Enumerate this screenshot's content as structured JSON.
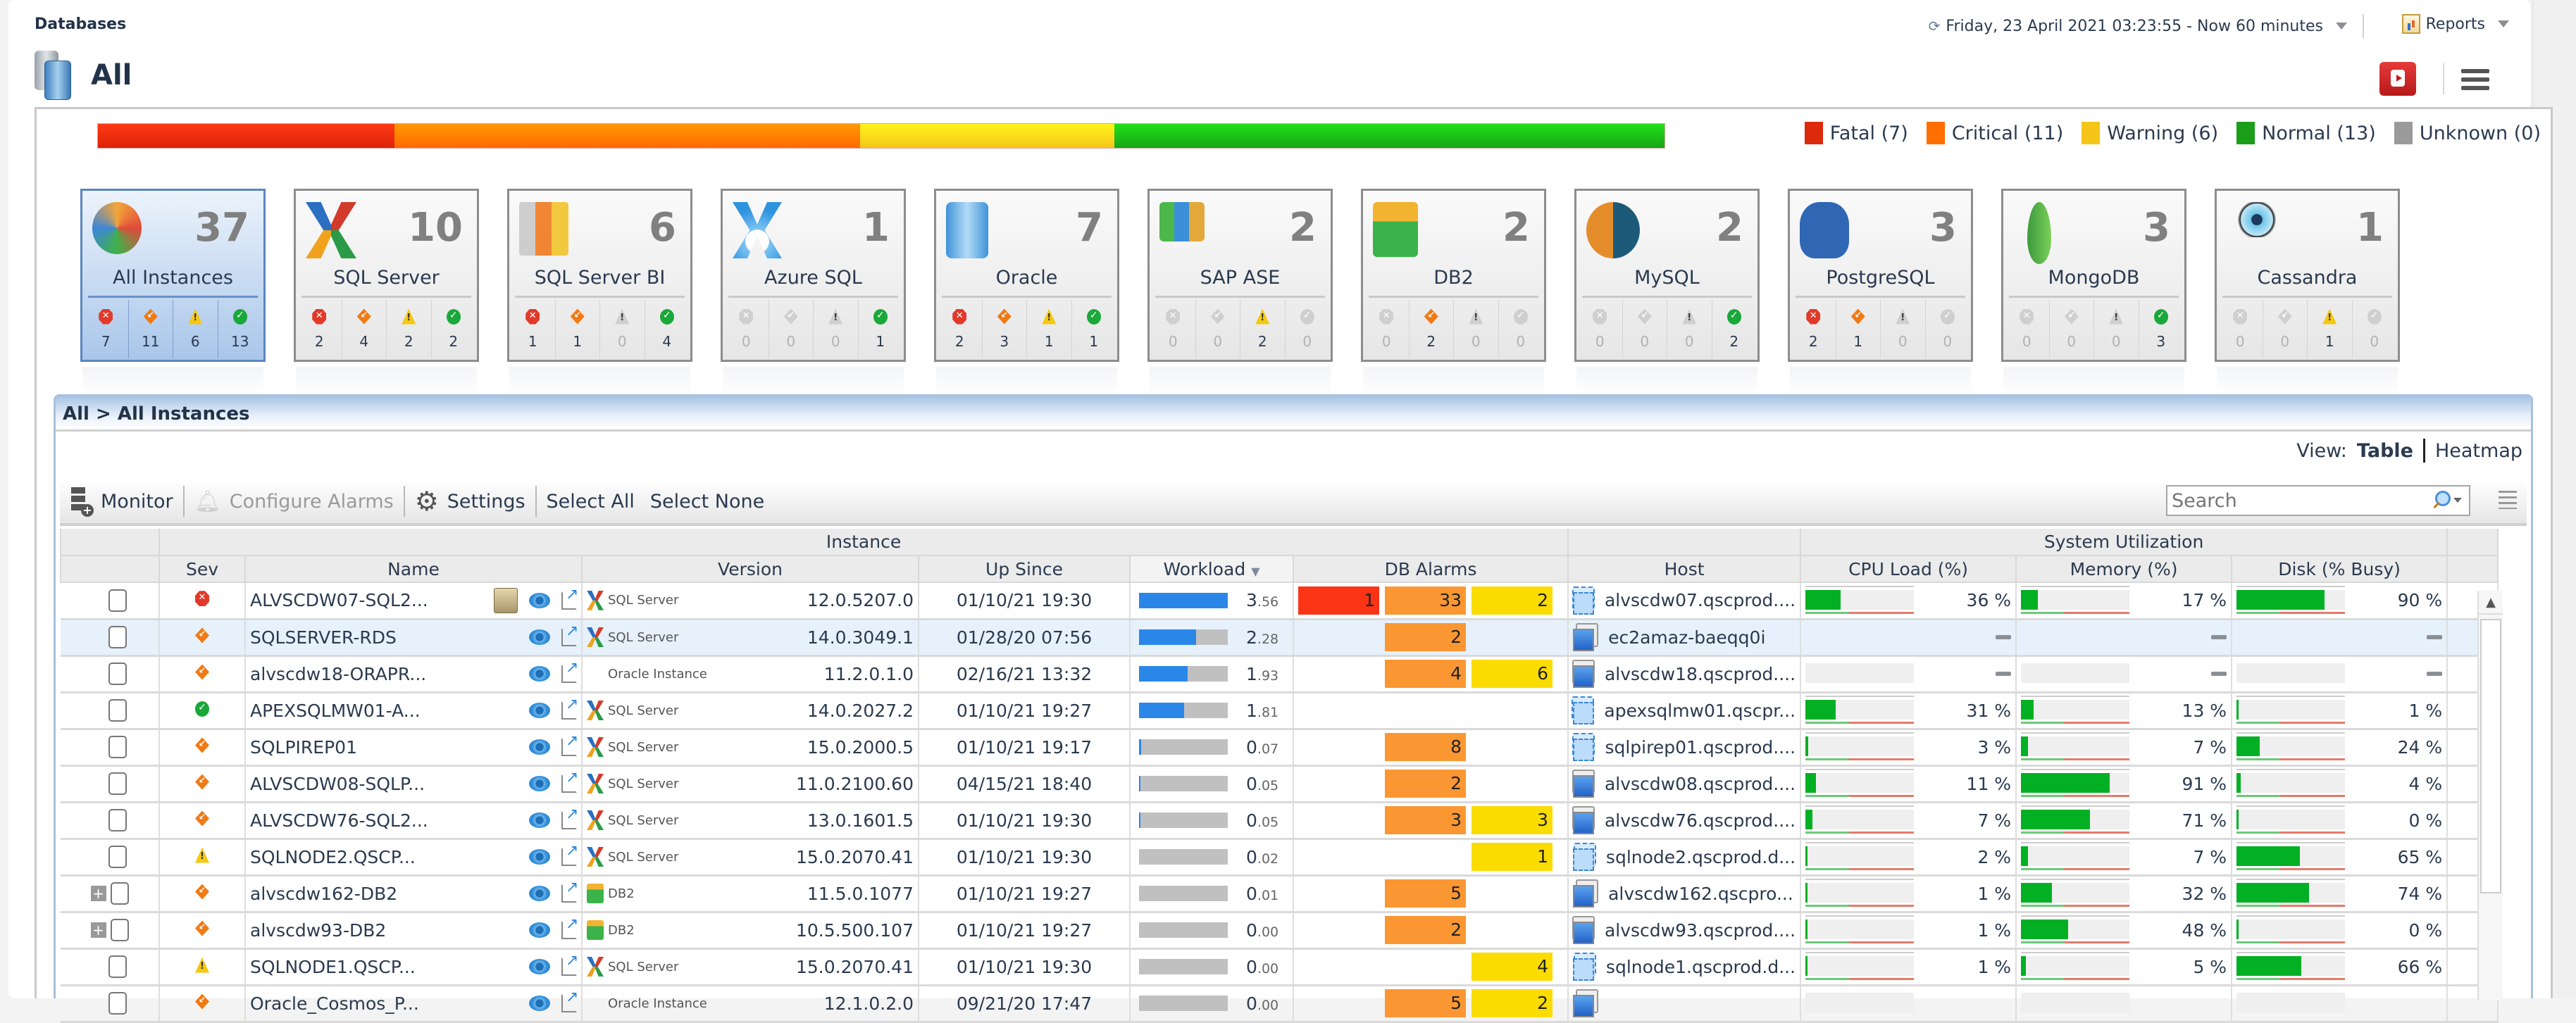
{
  "header": {
    "breadcrumb": "Databases",
    "time_range": "Friday, 23 April 2021 03:23:55 - Now 60 minutes",
    "reports_label": "Reports",
    "page_title": "All"
  },
  "health": {
    "legend": [
      {
        "key": "fatal",
        "label": "Fatal (7)",
        "count": 7,
        "color": "#dd2a0c"
      },
      {
        "key": "critical",
        "label": "Critical (11)",
        "count": 11,
        "color": "#ff6e00"
      },
      {
        "key": "warning",
        "label": "Warning (6)",
        "count": 6,
        "color": "#f5c518"
      },
      {
        "key": "normal",
        "label": "Normal (13)",
        "count": 13,
        "color": "#1a9e1a"
      },
      {
        "key": "unknown",
        "label": "Unknown (0)",
        "count": 0,
        "color": "#9a9a9a"
      }
    ],
    "total": 37
  },
  "cards": [
    {
      "name": "All Instances",
      "count": "37",
      "icon": "all-instances-icon",
      "selected": true,
      "stats": [
        "7",
        "11",
        "6",
        "13"
      ]
    },
    {
      "name": "SQL Server",
      "count": "10",
      "icon": "sql-server-icon",
      "selected": false,
      "stats": [
        "2",
        "4",
        "2",
        "2"
      ]
    },
    {
      "name": "SQL Server BI",
      "count": "6",
      "icon": "sql-server-bi-icon",
      "selected": false,
      "stats": [
        "1",
        "1",
        "0",
        "4"
      ]
    },
    {
      "name": "Azure SQL",
      "count": "1",
      "icon": "azure-sql-icon",
      "selected": false,
      "stats": [
        "0",
        "0",
        "0",
        "1"
      ]
    },
    {
      "name": "Oracle",
      "count": "7",
      "icon": "oracle-icon",
      "selected": false,
      "stats": [
        "2",
        "3",
        "1",
        "1"
      ]
    },
    {
      "name": "SAP ASE",
      "count": "2",
      "icon": "sap-ase-icon",
      "selected": false,
      "stats": [
        "0",
        "0",
        "2",
        "0"
      ]
    },
    {
      "name": "DB2",
      "count": "2",
      "icon": "db2-icon",
      "selected": false,
      "stats": [
        "0",
        "2",
        "0",
        "0"
      ]
    },
    {
      "name": "MySQL",
      "count": "2",
      "icon": "mysql-icon",
      "selected": false,
      "stats": [
        "0",
        "0",
        "0",
        "2"
      ]
    },
    {
      "name": "PostgreSQL",
      "count": "3",
      "icon": "postgresql-icon",
      "selected": false,
      "stats": [
        "2",
        "1",
        "0",
        "0"
      ]
    },
    {
      "name": "MongoDB",
      "count": "3",
      "icon": "mongodb-icon",
      "selected": false,
      "stats": [
        "0",
        "0",
        "0",
        "3"
      ]
    },
    {
      "name": "Cassandra",
      "count": "1",
      "icon": "cassandra-icon",
      "selected": false,
      "stats": [
        "0",
        "0",
        "1",
        "0"
      ]
    }
  ],
  "panel": {
    "breadcrumb": "All > All Instances",
    "view_label": "View:",
    "view_table": "Table",
    "view_heatmap": "Heatmap",
    "toolbar": {
      "monitor": "Monitor",
      "configure_alarms": "Configure Alarms",
      "settings": "Settings",
      "select_all": "Select All",
      "select_none": "Select None",
      "search_placeholder": "Search"
    },
    "group_headers": {
      "instance": "Instance",
      "system": "System Utilization"
    },
    "columns": {
      "sev": "Sev",
      "name": "Name",
      "version": "Version",
      "up_since": "Up Since",
      "workload": "Workload",
      "db_alarms": "DB Alarms",
      "host": "Host",
      "cpu": "CPU Load (%)",
      "memory": "Memory (%)",
      "disk": "Disk (% Busy)"
    }
  },
  "rows": [
    {
      "sev": "fatal",
      "name": "ALVSCDW07-SQL2...",
      "agent": true,
      "vendor": "sql",
      "vendor_label": "SQL Server",
      "version": "12.0.5207.0",
      "up_since": "01/10/21 19:30",
      "workload": "3.56",
      "workload_pct": 100,
      "alarms": {
        "fatal": "1",
        "critical": "33",
        "warning": "2"
      },
      "host": "alvscdw07.qscprod....",
      "host_virtual": true,
      "cpu": "36 %",
      "cpu_pct": 36,
      "mem": "17 %",
      "mem_pct": 17,
      "disk": "90 %",
      "disk_pct": 90,
      "expandable": false,
      "selected": false
    },
    {
      "sev": "critical",
      "name": "SQLSERVER-RDS",
      "agent": false,
      "vendor": "sql",
      "vendor_label": "SQL Server",
      "version": "14.0.3049.1",
      "up_since": "01/28/20 07:56",
      "workload": "2.28",
      "workload_pct": 64,
      "alarms": {
        "fatal": "",
        "critical": "2",
        "warning": ""
      },
      "host": "ec2amaz-baeqq0i",
      "host_virtual": false,
      "cpu": null,
      "cpu_pct": null,
      "mem": null,
      "mem_pct": null,
      "disk": null,
      "disk_pct": null,
      "no_bars": true,
      "expandable": false,
      "selected": true
    },
    {
      "sev": "critical",
      "name": "alvscdw18-ORAPR...",
      "agent": false,
      "vendor": "oracle",
      "vendor_label": "Oracle Instance",
      "version": "11.2.0.1.0",
      "up_since": "02/16/21 13:32",
      "workload": "1.93",
      "workload_pct": 55,
      "alarms": {
        "fatal": "",
        "critical": "4",
        "warning": "6"
      },
      "host": "alvscdw18.qscprod....",
      "host_virtual": false,
      "cpu": null,
      "cpu_pct": null,
      "mem": null,
      "mem_pct": null,
      "disk": null,
      "disk_pct": null,
      "no_bars": false,
      "expandable": false,
      "selected": false
    },
    {
      "sev": "normal",
      "name": "APEXSQLMW01-A...",
      "agent": false,
      "vendor": "sql",
      "vendor_label": "SQL Server",
      "version": "14.0.2027.2",
      "up_since": "01/10/21 19:27",
      "workload": "1.81",
      "workload_pct": 51,
      "alarms": {
        "fatal": "",
        "critical": "",
        "warning": ""
      },
      "host": "apexsqlmw01.qscpr...",
      "host_virtual": true,
      "cpu": "31 %",
      "cpu_pct": 31,
      "mem": "13 %",
      "mem_pct": 13,
      "disk": "1 %",
      "disk_pct": 1,
      "expandable": false,
      "selected": false
    },
    {
      "sev": "critical",
      "name": "SQLPIREP01",
      "agent": false,
      "vendor": "sql",
      "vendor_label": "SQL Server",
      "version": "15.0.2000.5",
      "up_since": "01/10/21 19:17",
      "workload": "0.07",
      "workload_pct": 2,
      "alarms": {
        "fatal": "",
        "critical": "8",
        "warning": ""
      },
      "host": "sqlpirep01.qscprod....",
      "host_virtual": true,
      "cpu": "3 %",
      "cpu_pct": 3,
      "mem": "7 %",
      "mem_pct": 7,
      "disk": "24 %",
      "disk_pct": 24,
      "expandable": false,
      "selected": false
    },
    {
      "sev": "critical",
      "name": "ALVSCDW08-SQLP...",
      "agent": false,
      "vendor": "sql",
      "vendor_label": "SQL Server",
      "version": "11.0.2100.60",
      "up_since": "04/15/21 18:40",
      "workload": "0.05",
      "workload_pct": 1,
      "alarms": {
        "fatal": "",
        "critical": "2",
        "warning": ""
      },
      "host": "alvscdw08.qscprod....",
      "host_virtual": false,
      "cpu": "11 %",
      "cpu_pct": 11,
      "mem": "91 %",
      "mem_pct": 91,
      "disk": "4 %",
      "disk_pct": 4,
      "expandable": false,
      "selected": false
    },
    {
      "sev": "critical",
      "name": "ALVSCDW76-SQL2...",
      "agent": false,
      "vendor": "sql",
      "vendor_label": "SQL Server",
      "version": "13.0.1601.5",
      "up_since": "01/10/21 19:30",
      "workload": "0.05",
      "workload_pct": 1,
      "alarms": {
        "fatal": "",
        "critical": "3",
        "warning": "3"
      },
      "host": "alvscdw76.qscprod....",
      "host_virtual": false,
      "cpu": "7 %",
      "cpu_pct": 7,
      "mem": "71 %",
      "mem_pct": 71,
      "disk": "0 %",
      "disk_pct": 0,
      "expandable": false,
      "selected": false
    },
    {
      "sev": "warning",
      "name": "SQLNODE2.QSCP...",
      "agent": false,
      "vendor": "sql",
      "vendor_label": "SQL Server",
      "version": "15.0.2070.41",
      "up_since": "01/10/21 19:30",
      "workload": "0.02",
      "workload_pct": 0,
      "alarms": {
        "fatal": "",
        "critical": "",
        "warning": "1"
      },
      "host": "sqlnode2.qscprod.d...",
      "host_virtual": true,
      "cpu": "2 %",
      "cpu_pct": 2,
      "mem": "7 %",
      "mem_pct": 7,
      "disk": "65 %",
      "disk_pct": 65,
      "expandable": false,
      "selected": false
    },
    {
      "sev": "critical",
      "name": "alvscdw162-DB2",
      "agent": false,
      "vendor": "db2",
      "vendor_label": "DB2",
      "version": "11.5.0.1077",
      "up_since": "01/10/21 19:27",
      "workload": "0.01",
      "workload_pct": 0,
      "alarms": {
        "fatal": "",
        "critical": "5",
        "warning": ""
      },
      "host": "alvscdw162.qscpro...",
      "host_virtual": false,
      "cpu": "1 %",
      "cpu_pct": 1,
      "mem": "32 %",
      "mem_pct": 32,
      "disk": "74 %",
      "disk_pct": 74,
      "expandable": true,
      "selected": false
    },
    {
      "sev": "critical",
      "name": "alvscdw93-DB2",
      "agent": false,
      "vendor": "db2",
      "vendor_label": "DB2",
      "version": "10.5.500.107",
      "up_since": "01/10/21 19:27",
      "workload": "0.00",
      "workload_pct": 0,
      "alarms": {
        "fatal": "",
        "critical": "2",
        "warning": ""
      },
      "host": "alvscdw93.qscprod....",
      "host_virtual": false,
      "cpu": "1 %",
      "cpu_pct": 1,
      "mem": "48 %",
      "mem_pct": 48,
      "disk": "0 %",
      "disk_pct": 0,
      "expandable": true,
      "selected": false
    },
    {
      "sev": "warning",
      "name": "SQLNODE1.QSCP...",
      "agent": false,
      "vendor": "sql",
      "vendor_label": "SQL Server",
      "version": "15.0.2070.41",
      "up_since": "01/10/21 19:30",
      "workload": "0.00",
      "workload_pct": 0,
      "alarms": {
        "fatal": "",
        "critical": "",
        "warning": "4"
      },
      "host": "sqlnode1.qscprod.d...",
      "host_virtual": true,
      "cpu": "1 %",
      "cpu_pct": 1,
      "mem": "5 %",
      "mem_pct": 5,
      "disk": "66 %",
      "disk_pct": 66,
      "expandable": false,
      "selected": false
    },
    {
      "sev": "critical",
      "name": "Oracle_Cosmos_P...",
      "agent": false,
      "vendor": "oracle",
      "vendor_label": "Oracle Instance",
      "version": "12.1.0.2.0",
      "up_since": "09/21/20 17:47",
      "workload": "0.00",
      "workload_pct": 0,
      "alarms": {
        "fatal": "",
        "critical": "5",
        "warning": "2"
      },
      "host": "",
      "host_virtual": false,
      "cpu": "",
      "cpu_pct": null,
      "mem": "",
      "mem_pct": null,
      "disk": "",
      "disk_pct": null,
      "expandable": false,
      "selected": false
    }
  ]
}
